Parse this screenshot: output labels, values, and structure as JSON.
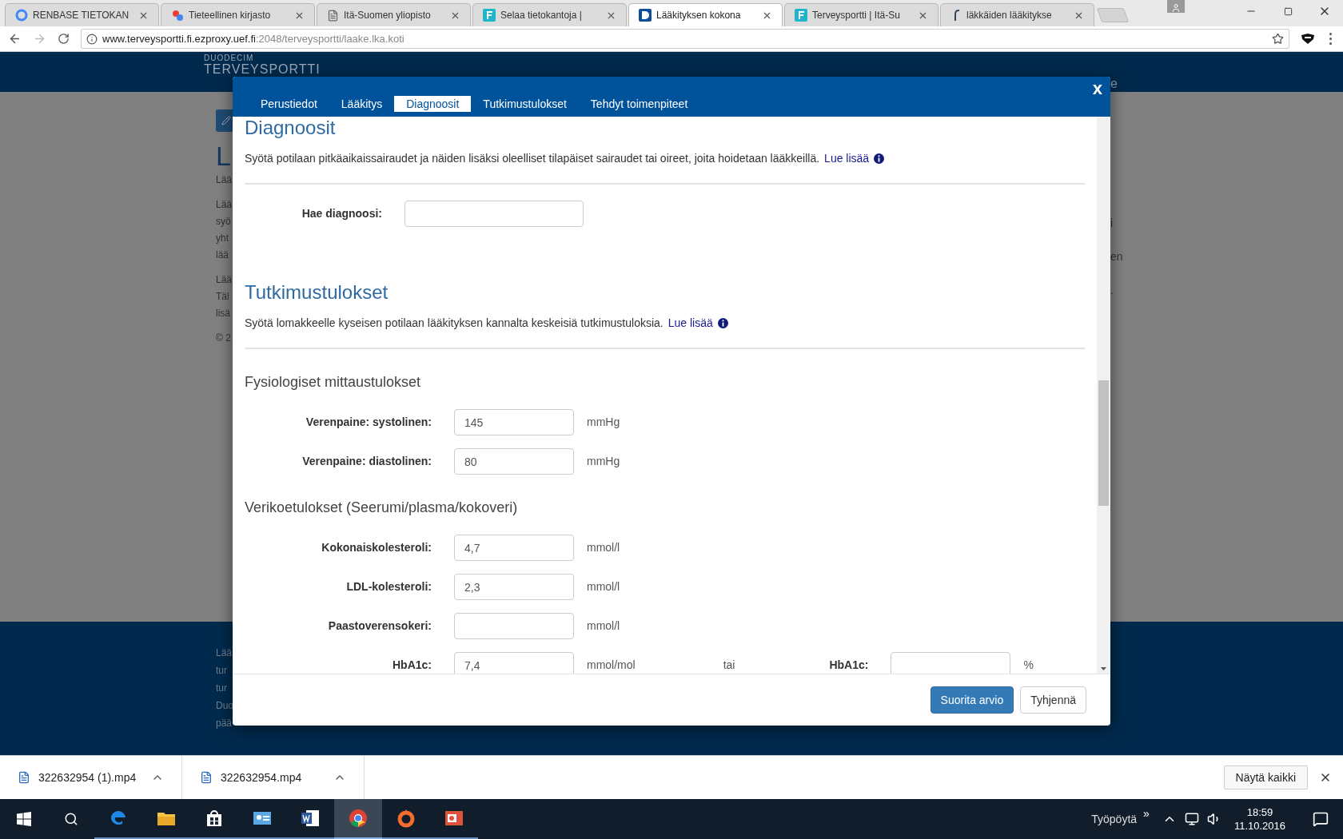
{
  "browser": {
    "tabs": [
      {
        "title": "RENBASE TIETOKAN",
        "selected": false,
        "kind": "google"
      },
      {
        "title": "Tieteellinen kirjasto",
        "selected": false,
        "kind": "puzzle"
      },
      {
        "title": "Itä-Suomen yliopisto",
        "selected": false,
        "kind": "page"
      },
      {
        "title": "Selaa tietokantoja |",
        "selected": false,
        "kind": "f"
      },
      {
        "title": "Lääkityksen kokona",
        "selected": true,
        "kind": "d"
      },
      {
        "title": "Terveysportti | Itä-Su",
        "selected": false,
        "kind": "f"
      },
      {
        "title": "läkkäiden lääkitykse",
        "selected": false,
        "kind": "finna"
      }
    ],
    "address": {
      "host": "www.terveysportti.fi.ezproxy.uef.fi",
      "path": ":2048/terveysportti/laake.lka.koti"
    }
  },
  "background_page": {
    "brand_small": "DUODECIM",
    "brand": "TERVEYSPORTTI",
    "header_right": "e",
    "heading": "L",
    "left_paragraphs": [
      [
        "Lää"
      ],
      [
        "Lää",
        "syö",
        "yht",
        "lää"
      ],
      [
        "Lää",
        "Täl",
        "lisä"
      ],
      [
        "© 2"
      ]
    ],
    "right_paragraphs": [
      [
        "i"
      ],
      [
        "en"
      ],
      [
        "."
      ]
    ],
    "footer_lines": [
      "Lää",
      "tur",
      "tur",
      "Duo",
      "pää"
    ]
  },
  "modal": {
    "tabs": [
      {
        "label": "Perustiedot",
        "selected": false
      },
      {
        "label": "Lääkitys",
        "selected": false
      },
      {
        "label": "Diagnoosit",
        "selected": true
      },
      {
        "label": "Tutkimustulokset",
        "selected": false
      },
      {
        "label": "Tehdyt toimenpiteet",
        "selected": false
      }
    ],
    "close": "x",
    "sections": [
      {
        "title": "Diagnoosit",
        "description": "Syötä potilaan pitkäaikaissairaudet ja näiden lisäksi oleelliset tilapäiset sairaudet tai oireet, joita hoidetaan lääkkeillä.",
        "link": "Lue lisää",
        "groups": [
          {
            "fields": [
              {
                "label": "Hae diagnoosi:",
                "wide": true
              }
            ]
          }
        ]
      },
      {
        "title": "Tutkimustulokset",
        "description": "Syötä lomakkeelle kyseisen potilaan lääkityksen kannalta keskeisiä tutkimustuloksia.",
        "link": "Lue lisää",
        "groups": [
          {
            "title": "Fysiologiset mittaustulokset",
            "fields": [
              {
                "label": "Verenpaine: systolinen:",
                "value": "145",
                "unit": "mmHg"
              },
              {
                "label": "Verenpaine: diastolinen:",
                "value": "80",
                "unit": "mmHg"
              }
            ]
          },
          {
            "title": "Verikoetulokset (Seerumi/plasma/kokoveri)",
            "fields": [
              {
                "label": "Kokonaiskolesteroli:",
                "value": "4,7",
                "unit": "mmol/l"
              },
              {
                "label": "LDL-kolesteroli:",
                "value": "2,3",
                "unit": "mmol/l"
              },
              {
                "label": "Paastoverensokeri:",
                "unit": "mmol/l"
              },
              {
                "label": "HbA1c:",
                "value": "7,4",
                "unit": "mmol/mol",
                "or": "tai",
                "alt": {
                  "label": "HbA1c:",
                  "unit": "%"
                }
              }
            ]
          }
        ]
      }
    ],
    "buttons": [
      {
        "label": "Suorita arvio",
        "kind": "primary"
      },
      {
        "label": "Tyhjennä",
        "kind": "default"
      }
    ]
  },
  "downloads": {
    "items": [
      "322632954 (1).mp4",
      "322632954.mp4"
    ],
    "show_all": "Näytä kaikki"
  },
  "taskbar": {
    "apps": [
      {
        "kind": "edge",
        "selected": false
      },
      {
        "kind": "folder",
        "selected": false
      },
      {
        "kind": "store",
        "selected": false
      },
      {
        "kind": "card",
        "selected": false
      },
      {
        "kind": "word",
        "selected": false
      },
      {
        "kind": "chrome",
        "selected": true
      },
      {
        "kind": "origin",
        "selected": false
      },
      {
        "kind": "slides",
        "selected": false
      }
    ],
    "desktop": "Työpöytä",
    "more": "»",
    "time": "18:59",
    "date": "11.10.2016"
  }
}
